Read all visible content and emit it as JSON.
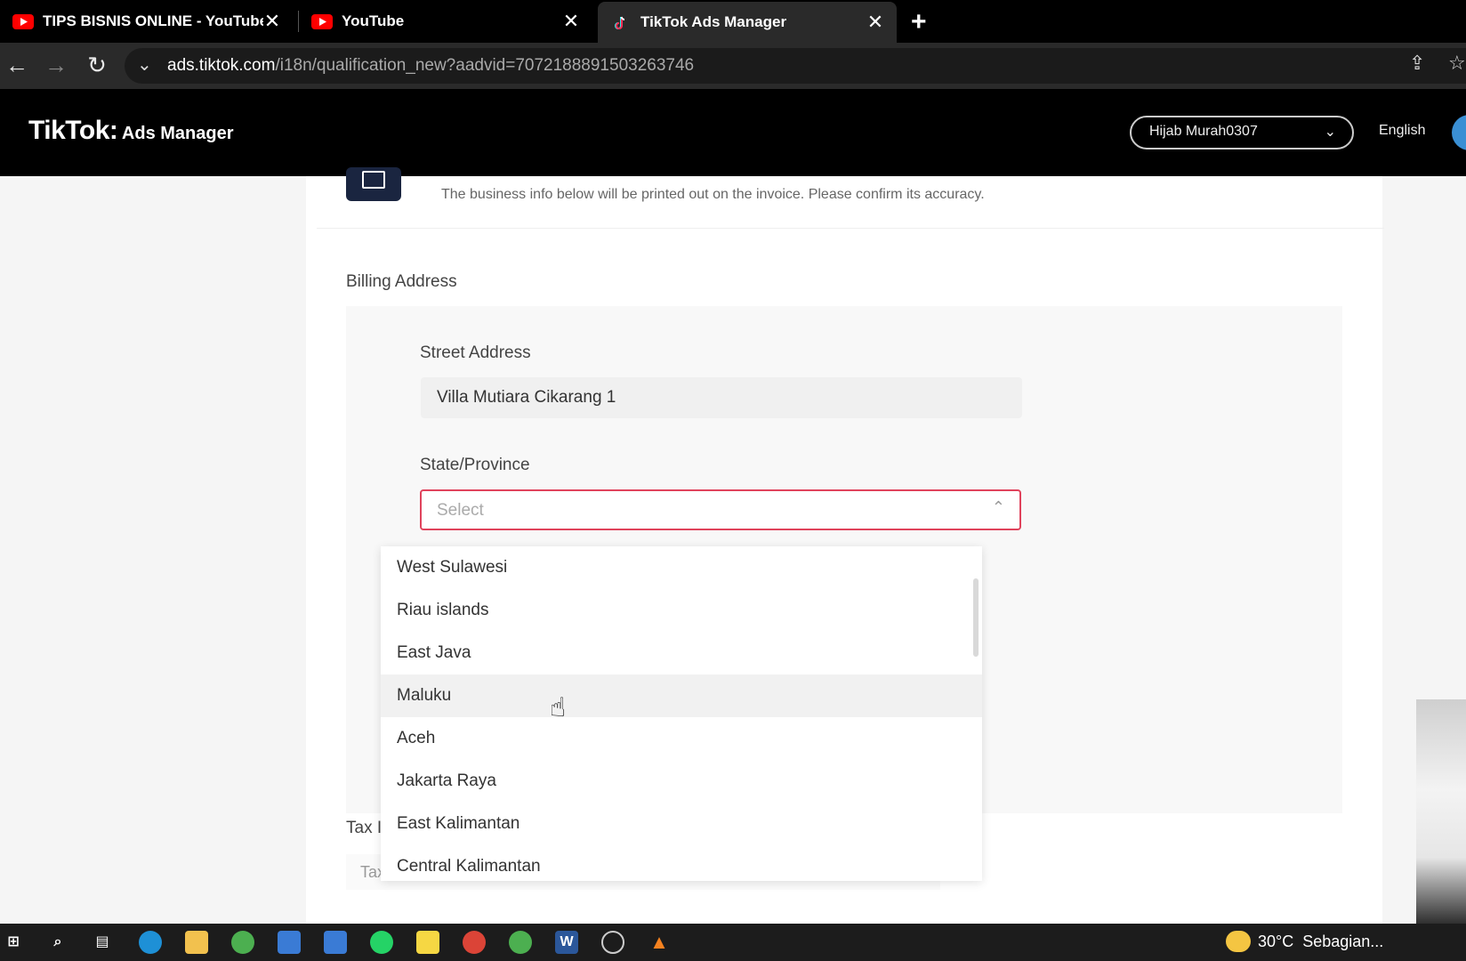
{
  "browser": {
    "tabs": [
      {
        "title": "TIPS BISNIS ONLINE - YouTube",
        "icon": "youtube-icon",
        "active": false
      },
      {
        "title": "YouTube",
        "icon": "youtube-icon",
        "active": false
      },
      {
        "title": "TikTok Ads Manager",
        "icon": "tiktok-icon",
        "active": true
      }
    ],
    "close_glyph": "✕",
    "new_tab_glyph": "+",
    "url_domain": "ads.tiktok.com",
    "url_path": "/i18n/qualification_new?aadvid=7072188891503263746"
  },
  "header": {
    "brand": "TikTok",
    "brand_dot": ":",
    "product": "Ads Manager",
    "account": "Hijab Murah0307",
    "language": "English"
  },
  "invoice": {
    "description": "The business info below will be printed out on the invoice. Please confirm its accuracy."
  },
  "billing": {
    "section_label": "Billing Address",
    "street_label": "Street Address",
    "street_value": "Villa Mutiara Cikarang 1",
    "state_label": "State/Province",
    "state_placeholder": "Select",
    "options": [
      "West Sulawesi",
      "Riau islands",
      "East Java",
      "Maluku",
      "Aceh",
      "Jakarta Raya",
      "East Kalimantan",
      "Central Kalimantan"
    ],
    "hovered_option": "Maluku"
  },
  "tax": {
    "label_partial": "Tax I",
    "row_label": "Tax Information",
    "add_glyph": "+"
  },
  "taskbar": {
    "weather_temp": "30°C",
    "weather_text": "Sebagian..."
  },
  "colors": {
    "error_border": "#e0435c",
    "header_bg": "#000000",
    "youtube_red": "#ff0000"
  }
}
